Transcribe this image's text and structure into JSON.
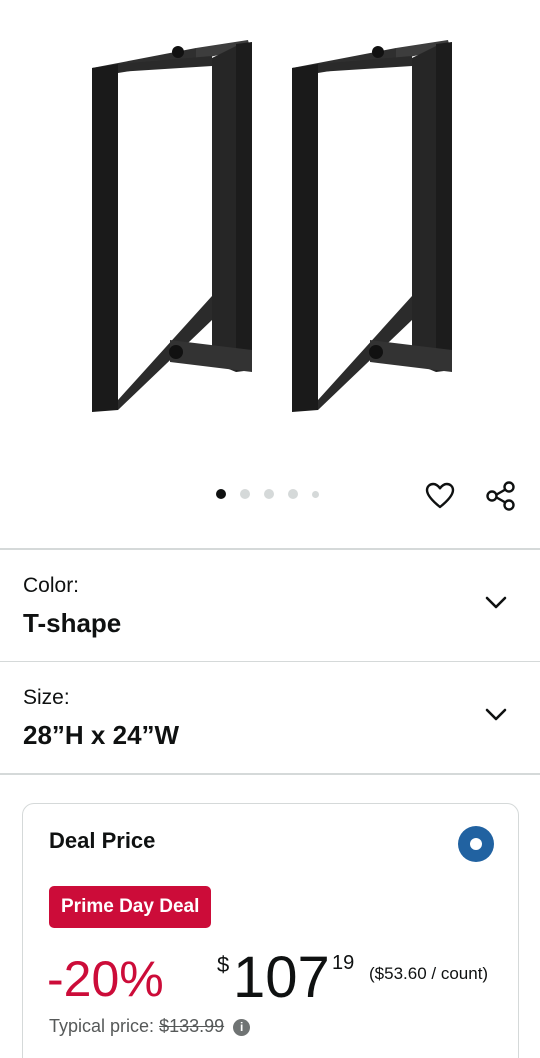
{
  "product_image": {
    "icon": "table-leg-pair-image"
  },
  "gallery": {
    "dots": 5,
    "active_index": 0
  },
  "actions": {
    "favorite_icon": "heart-icon",
    "share_icon": "share-icon"
  },
  "color": {
    "label": "Color:",
    "value": "T-shape"
  },
  "size": {
    "label": "Size:",
    "value": "28”H x 24”W"
  },
  "deal": {
    "title": "Deal Price",
    "badge": "Prime Day Deal",
    "discount": "-20%",
    "currency": "$",
    "price_whole": "107",
    "price_fraction": "19",
    "unit_price": "($53.60 / count)",
    "typical_label": "Typical price:",
    "typical_price": "$133.99",
    "info_glyph": "i"
  },
  "colors": {
    "deal_red": "#cc0c39",
    "radio_blue": "#2162a1",
    "divider": "#d5d9d9"
  }
}
